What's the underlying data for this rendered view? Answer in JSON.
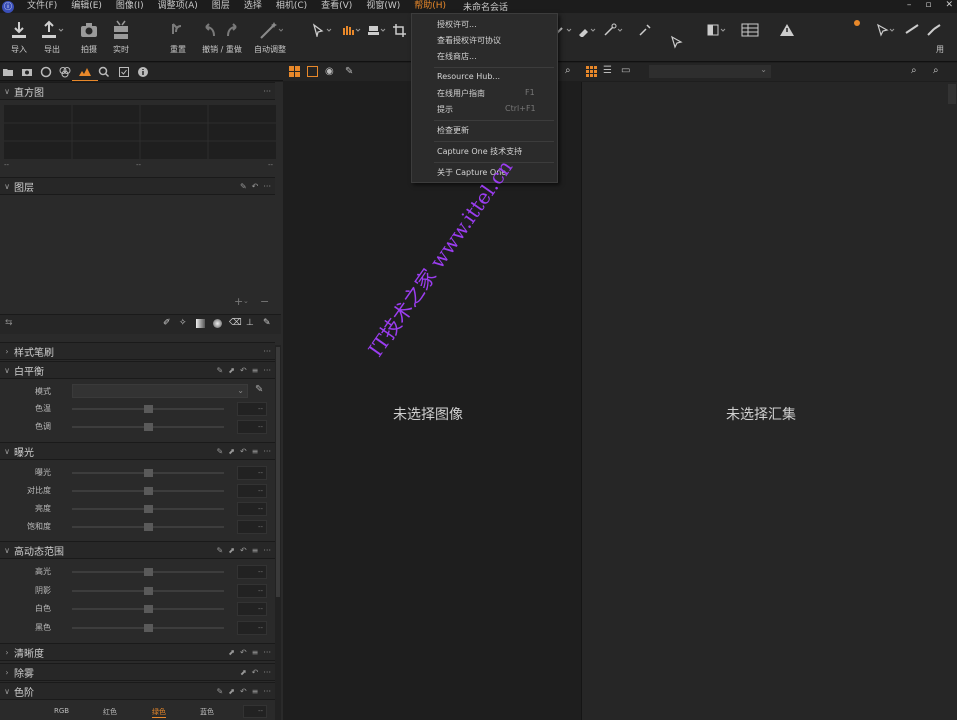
{
  "menubar": {
    "items": [
      "文件(F)",
      "编辑(E)",
      "图像(I)",
      "调整项(A)",
      "图层",
      "选择",
      "相机(C)",
      "查看(V)",
      "视窗(W)",
      "帮助(H)"
    ],
    "active_item": "帮助(H)",
    "session_title": "未命名会话"
  },
  "toolbar": {
    "import_label": "导入",
    "export_label": "导出",
    "capture_label": "拍摄",
    "live_label": "实时",
    "reset_label": "重置",
    "undo_redo_label": "撤销 / 重做",
    "auto_adjust_label": "自动调整",
    "right_trunc_label": "用"
  },
  "help_menu": {
    "items": [
      {
        "label": "授权许可...",
        "shortcut": ""
      },
      {
        "label": "查看授权许可协议",
        "shortcut": ""
      },
      {
        "label": "在线商店...",
        "shortcut": ""
      },
      {
        "label": "Resource Hub...",
        "shortcut": ""
      },
      {
        "label": "在线用户指南",
        "shortcut": "F1"
      },
      {
        "label": "提示",
        "shortcut": "Ctrl+F1"
      },
      {
        "label": "检查更新",
        "shortcut": ""
      },
      {
        "label": "Capture One 技术支持",
        "shortcut": ""
      },
      {
        "label": "关于 Capture One",
        "shortcut": ""
      }
    ]
  },
  "histogram": {
    "title": "直方图",
    "left_value": "--",
    "mid_value": "--",
    "right_value": "--"
  },
  "layers": {
    "title": "图层"
  },
  "style_brush": {
    "title": "样式笔刷"
  },
  "white_balance": {
    "title": "白平衡",
    "mode_label": "模式",
    "rows": [
      {
        "label": "色温",
        "value": "--"
      },
      {
        "label": "色调",
        "value": "--"
      }
    ]
  },
  "exposure": {
    "title": "曝光",
    "rows": [
      {
        "label": "曝光",
        "value": "--"
      },
      {
        "label": "对比度",
        "value": "--"
      },
      {
        "label": "亮度",
        "value": "--"
      },
      {
        "label": "饱和度",
        "value": "--"
      }
    ]
  },
  "hdr": {
    "title": "高动态范围",
    "rows": [
      {
        "label": "高光",
        "value": "--"
      },
      {
        "label": "阴影",
        "value": "--"
      },
      {
        "label": "白色",
        "value": "--"
      },
      {
        "label": "黑色",
        "value": "--"
      }
    ]
  },
  "clarity": {
    "title": "清晰度"
  },
  "dehaze": {
    "title": "除雾"
  },
  "levels": {
    "title": "色阶",
    "tabs": [
      "RGB",
      "红色",
      "绿色",
      "蓝色"
    ],
    "active_tab": "绿色",
    "value": "--"
  },
  "viewer": {
    "empty_text": "未选择图像"
  },
  "browser": {
    "empty_text": "未选择汇集"
  },
  "watermark": "IT技术之家 www.ittel.cn",
  "colors": {
    "accent": "#e8882a",
    "watermark": "#9b3df0"
  }
}
